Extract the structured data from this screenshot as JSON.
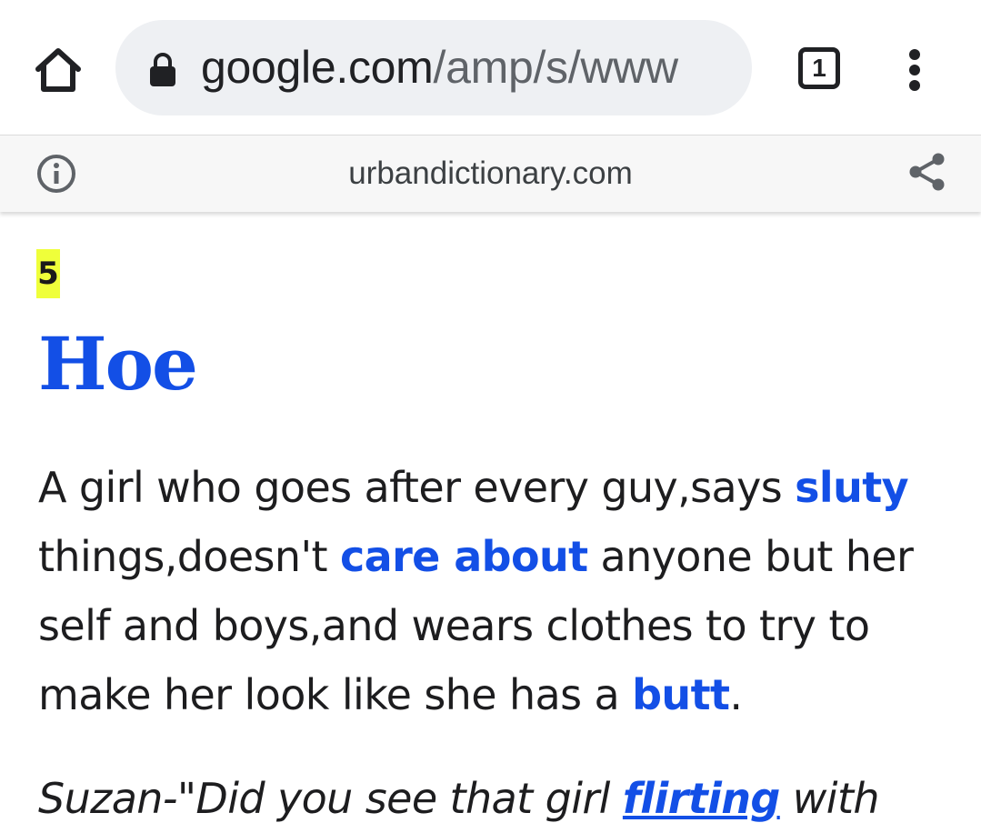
{
  "toolbar": {
    "url_host": "google.com",
    "url_path": "/amp/s/www",
    "tab_count": "1",
    "icons": {
      "home": "home-icon",
      "lock": "lock-icon",
      "menu": "more-vert-icon"
    }
  },
  "amp_bar": {
    "domain": "urbandictionary.com",
    "icons": {
      "info": "info-icon",
      "share": "share-icon"
    }
  },
  "entry": {
    "rank": "5",
    "word": "Hoe",
    "meaning": {
      "part1": "A girl who goes after every guy,says ",
      "link1": "sluty",
      "part2": " things,doesn't ",
      "link2": "care about",
      "part3": " anyone but her self and boys,and wears clothes to try to make her look like she has a ",
      "link3": "butt",
      "part4": "."
    },
    "example": {
      "part1": "Suzan-\"Did you see that girl ",
      "link1": "flirting",
      "part2": " with"
    }
  },
  "colors": {
    "link": "#134fe6",
    "rank_highlight": "#efff3a",
    "urlbar_bg": "#eef0f3"
  }
}
